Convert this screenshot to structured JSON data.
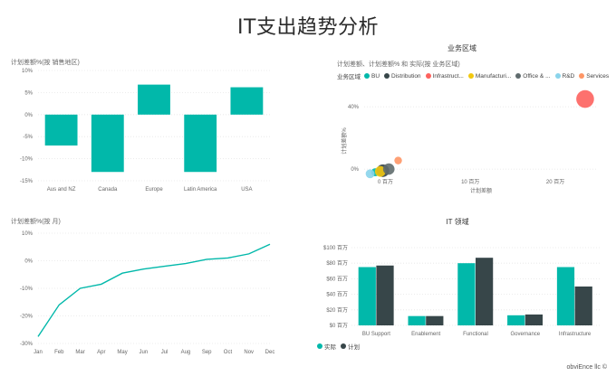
{
  "page": {
    "title": "IT支出趋势分析",
    "footer": "obviEnce llc ©"
  },
  "colors": {
    "teal": "#01b8aa",
    "dark": "#374649",
    "red": "#fd625e",
    "yellow": "#f2c80f",
    "gray": "#5f6b6d",
    "lightblue": "#8ad4eb",
    "orange": "#fe9666"
  },
  "chart_data": [
    {
      "id": "region",
      "type": "bar",
      "title": "计划差额%(按 销售地区)",
      "categories": [
        "Aus and NZ",
        "Canada",
        "Europe",
        "Latin America",
        "USA"
      ],
      "values": [
        -7,
        -13,
        6.8,
        -13,
        6.2
      ],
      "ylim": [
        -15,
        10
      ],
      "yticks": [
        10,
        5,
        0,
        -5,
        -10,
        -15
      ],
      "ytick_labels": [
        "10%",
        "5%",
        "0%",
        "-5%",
        "-10%",
        "-15%"
      ],
      "color": "#01b8aa"
    },
    {
      "id": "scatter",
      "type": "scatter",
      "title": "业务区域",
      "subtitle": "计划差额、计划差额% 和 实际(按 业务区域)",
      "legend_title": "业务区域",
      "xlabel": "计划差额",
      "ylabel": "计划差额%",
      "xlim": [
        -2.5,
        25
      ],
      "ylim": [
        -4,
        54
      ],
      "xticks": [
        0,
        10,
        20
      ],
      "xtick_labels": [
        "0 百万",
        "10 百万",
        "20 百万"
      ],
      "yticks": [
        0,
        40
      ],
      "ytick_labels": [
        "0%",
        "40%"
      ],
      "series": [
        {
          "name": "BU",
          "color": "#01b8aa",
          "x": -1.2,
          "y": -2,
          "size": 0.32
        },
        {
          "name": "Distribution",
          "color": "#374649",
          "x": -0.3,
          "y": -1,
          "size": 0.5
        },
        {
          "name": "Infrastruct...",
          "color": "#fd625e",
          "x": 23.5,
          "y": 45,
          "size": 0.7
        },
        {
          "name": "Manufacturi...",
          "color": "#f2c80f",
          "x": -0.6,
          "y": -1.5,
          "size": 0.42
        },
        {
          "name": "Office & ...",
          "color": "#5f6b6d",
          "x": 0.4,
          "y": 0,
          "size": 0.45
        },
        {
          "name": "R&D",
          "color": "#8ad4eb",
          "x": -1.8,
          "y": -3,
          "size": 0.35
        },
        {
          "name": "Services",
          "color": "#fe9666",
          "x": 1.5,
          "y": 5.5,
          "size": 0.3
        }
      ]
    },
    {
      "id": "monthly",
      "type": "line",
      "title": "计划差额%(按 月)",
      "categories": [
        "Jan",
        "Feb",
        "Mar",
        "Apr",
        "May",
        "Jun",
        "Jul",
        "Aug",
        "Sep",
        "Oct",
        "Nov",
        "Dec"
      ],
      "values": [
        -27.5,
        -16,
        -10,
        -8.5,
        -4.5,
        -3,
        -2,
        -1,
        0.5,
        1,
        2.5,
        6
      ],
      "ylim": [
        -30,
        10
      ],
      "yticks": [
        10,
        0,
        -10,
        -20,
        -30
      ],
      "ytick_labels": [
        "10%",
        "0%",
        "-10%",
        "-20%",
        "-30%"
      ],
      "color": "#01b8aa"
    },
    {
      "id": "itdomain",
      "type": "bar",
      "title": "IT 领域",
      "categories": [
        "BU Support",
        "Enablement",
        "Functional",
        "Governance",
        "Infrastructure"
      ],
      "series": [
        {
          "name": "实际",
          "color": "#01b8aa",
          "values": [
            75,
            12,
            80,
            13,
            75
          ]
        },
        {
          "name": "计划",
          "color": "#374649",
          "values": [
            77,
            12,
            87,
            14,
            50
          ]
        }
      ],
      "ylim": [
        0,
        100
      ],
      "yticks": [
        100,
        80,
        60,
        40,
        20,
        0
      ],
      "ytick_labels": [
        "$100 百万",
        "$80 百万",
        "$60 百万",
        "$40 百万",
        "$20 百万",
        "$0 百万"
      ]
    }
  ]
}
